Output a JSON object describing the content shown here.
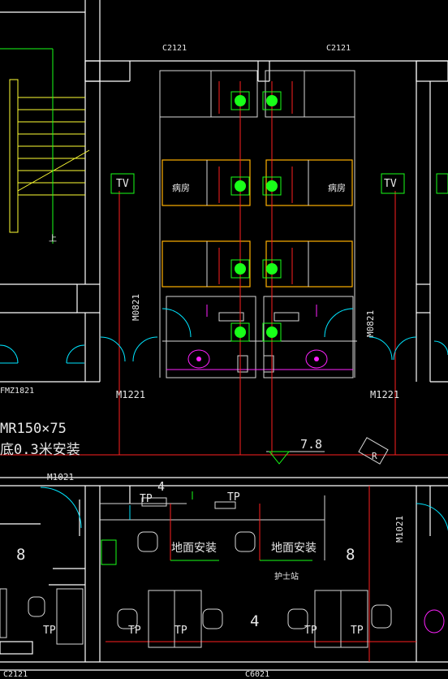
{
  "labels": {
    "c2121_top_left": "C2121",
    "c2121_top_right": "C2121",
    "tv_left": "TV",
    "tv_right": "TV",
    "ward_left": "病房",
    "ward_right": "病房",
    "up": "上",
    "m0821_left": "M0821",
    "m0821_right": "M0821",
    "fm": "FMZ1821",
    "m1221_left": "M1221",
    "m1221_right": "M1221",
    "mr_spec": "MR150×75",
    "install_note": "底0.3米安装",
    "elevation": "7.8",
    "r_mark": "R",
    "m1021_left": "M1021",
    "m1021_right": "M1021",
    "num_4_top": "4",
    "tp_top_left": "TP",
    "tp_top_right": "TP",
    "floor_install_left": "地面安装",
    "floor_install_right": "地面安装",
    "num_8_left": "8",
    "num_8_right": "8",
    "nurse_station": "护士站",
    "tp_bottom_1": "TP",
    "tp_bottom_2": "TP",
    "tp_bottom_3": "TP",
    "tp_bottom_4": "TP",
    "tp_bottom_5": "TP",
    "tp_bottom_6": "TP",
    "num_4_bottom": "4",
    "c2121_bottom": "C2121",
    "c6021_bottom": "C6021"
  },
  "colors": {
    "wall": "#ffffff",
    "red": "#ff2020",
    "cyan": "#00e5ff",
    "green": "#19ff19",
    "yellow": "#ffff33",
    "orange": "#ffb000",
    "magenta": "#ff22ff"
  }
}
